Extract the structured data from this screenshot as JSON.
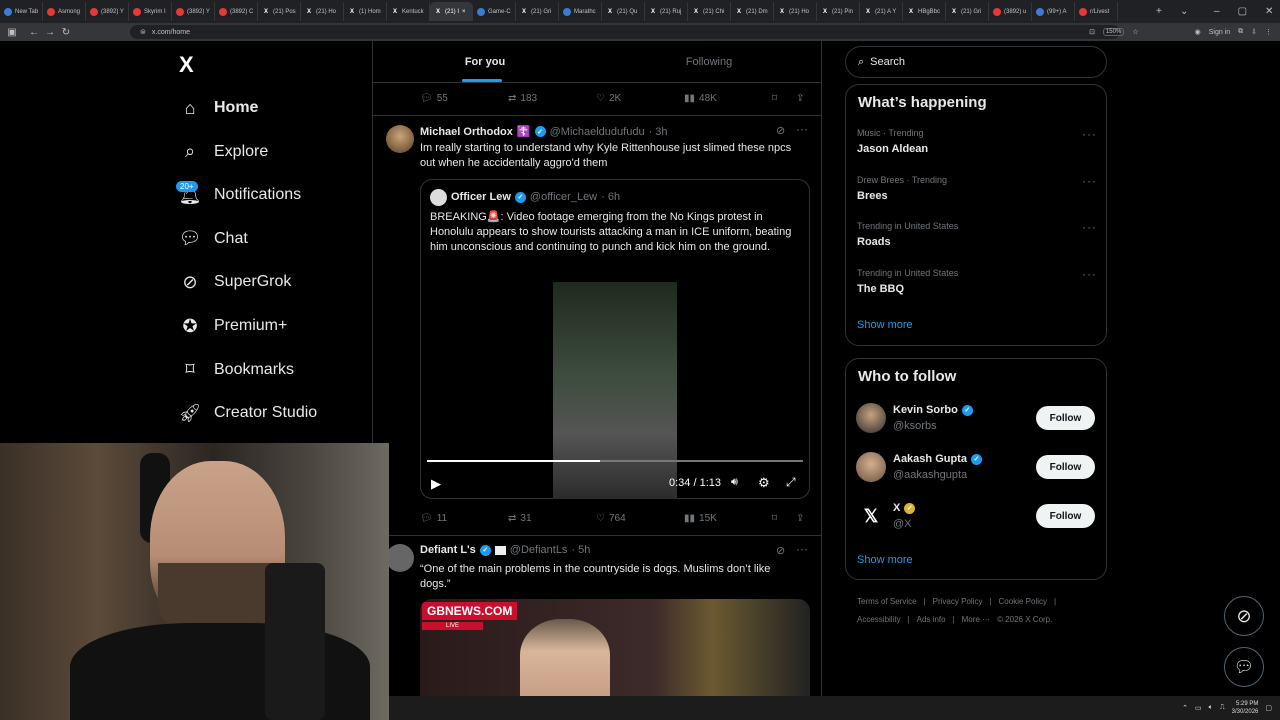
{
  "browser": {
    "tabs": [
      {
        "label": "New Tab",
        "icon": "blue"
      },
      {
        "label": "Asmong",
        "icon": "red"
      },
      {
        "label": "(3892) Y",
        "icon": "red"
      },
      {
        "label": "Skyrim I",
        "icon": "red"
      },
      {
        "label": "(3892) Y",
        "icon": "red"
      },
      {
        "label": "(3892) C",
        "icon": "red"
      },
      {
        "label": "(21) Pos",
        "icon": "x"
      },
      {
        "label": "(21) Ho",
        "icon": "x"
      },
      {
        "label": "(1) Hom",
        "icon": "x"
      },
      {
        "label": "Kentuck",
        "icon": "x"
      },
      {
        "label": "(21) I",
        "icon": "x",
        "active": true
      },
      {
        "label": "Game-C",
        "icon": "blue"
      },
      {
        "label": "(21) Gri",
        "icon": "x"
      },
      {
        "label": "Marathc",
        "icon": "blue"
      },
      {
        "label": "(21) Qu",
        "icon": "x"
      },
      {
        "label": "(21) Ruj",
        "icon": "x"
      },
      {
        "label": "(21) Chi",
        "icon": "x"
      },
      {
        "label": "(21) Dm",
        "icon": "x"
      },
      {
        "label": "(21) Ho",
        "icon": "x"
      },
      {
        "label": "(21) Pin",
        "icon": "x"
      },
      {
        "label": "(21) A Y",
        "icon": "x"
      },
      {
        "label": "HBgBbc",
        "icon": "x"
      },
      {
        "label": "(21) Gri",
        "icon": "x"
      },
      {
        "label": "(3892) u",
        "icon": "red"
      },
      {
        "label": "(99+) A",
        "icon": "blue"
      },
      {
        "label": "r/Livest",
        "icon": "red"
      }
    ],
    "url": "x.com/home",
    "zoom": "150%",
    "sign_in": "Sign in"
  },
  "nav": {
    "logo": "X",
    "items": [
      {
        "label": "Home",
        "icon": "home-icon"
      },
      {
        "label": "Explore",
        "icon": "search-icon"
      },
      {
        "label": "Notifications",
        "icon": "bell-icon"
      },
      {
        "label": "Chat",
        "icon": "chat-icon"
      },
      {
        "label": "SuperGrok",
        "icon": "grok-icon"
      },
      {
        "label": "Premium+",
        "icon": "premium-icon"
      },
      {
        "label": "Bookmarks",
        "icon": "bookmark-icon"
      },
      {
        "label": "Creator Studio",
        "icon": "rocket-icon"
      }
    ],
    "notif_badge": "20+"
  },
  "feed": {
    "tabs": [
      "For you",
      "Following"
    ],
    "prev_actions": {
      "replies": "55",
      "reposts": "183",
      "likes": "2K",
      "views": "48K"
    },
    "tweet1": {
      "name": "Michael Orthodox",
      "emoji": "☦️",
      "handle": "@Michaeldudufudu",
      "time": "· 3h",
      "text": "Im really starting to understand why Kyle Rittenhouse just slimed these npcs out when he accidentally aggro'd them",
      "quote": {
        "name": "Officer Lew",
        "handle": "@officer_Lew",
        "time": "· 6h",
        "text": "BREAKING🚨: Video footage emerging from the No Kings protest in Honolulu appears to show tourists attacking a man in ICE uniform, beating him unconscious and continuing to punch and kick him on the ground.",
        "video_time": "0:34 / 1:13",
        "progress": 0.46
      },
      "actions": {
        "replies": "11",
        "reposts": "31",
        "likes": "764",
        "views": "15K"
      }
    },
    "tweet2": {
      "name": "Defiant L's",
      "handle": "@DefiantLs",
      "time": "· 5h",
      "text": "“One of the main problems in the countryside is dogs. Muslims don’t like dogs.”",
      "media_logo": "GBNEWS.COM",
      "media_live": "LIVE"
    }
  },
  "right": {
    "search_placeholder": "Search",
    "happening_title": "What’s happening",
    "trends": [
      {
        "context": "Music · Trending",
        "name": "Jason Aldean"
      },
      {
        "context": "Drew Brees · Trending",
        "name": "Brees"
      },
      {
        "context": "Trending in United States",
        "name": "Roads"
      },
      {
        "context": "Trending in United States",
        "name": "The BBQ"
      }
    ],
    "show_more": "Show more",
    "wtf_title": "Who to follow",
    "follow": [
      {
        "name": "Kevin Sorbo",
        "handle": "@ksorbs",
        "badge": "blue"
      },
      {
        "name": "Aakash Gupta",
        "handle": "@aakashgupta",
        "badge": "blue"
      },
      {
        "name": "X",
        "handle": "@X",
        "badge": "gold"
      }
    ],
    "follow_label": "Follow",
    "footer": [
      "Terms of Service",
      "Privacy Policy",
      "Cookie Policy",
      "Accessibility",
      "Ads info",
      "More ···",
      "© 2026 X Corp."
    ]
  },
  "taskbar": {
    "time": "5:29 PM",
    "date": "3/30/2026"
  }
}
